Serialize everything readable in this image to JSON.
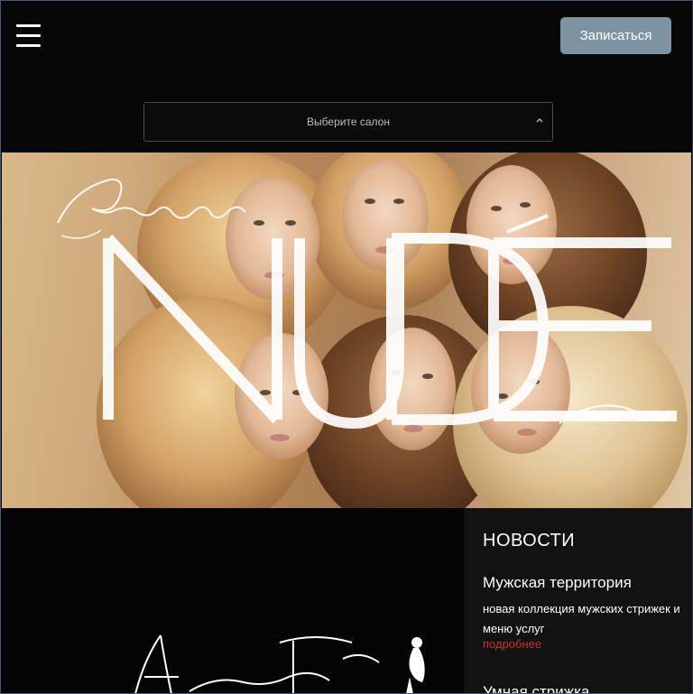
{
  "header": {
    "menu_icon": "hamburger-menu-icon",
    "book_button_label": "Записаться"
  },
  "salon_select": {
    "selected_label": "Выберите салон",
    "chevron_icon": "chevron-up-icon"
  },
  "hero": {
    "script_text": "Городской",
    "brand_text": "NUDE"
  },
  "news": {
    "heading": "НОВОСТИ",
    "items": [
      {
        "title": "Мужская территория",
        "description": "новая коллекция мужских стрижек и меню услуг",
        "more_link": "подробнее"
      },
      {
        "title": "Умная стрижка"
      }
    ]
  },
  "colors": {
    "book_button_bg": "#7d93a2",
    "more_link": "#c7332b",
    "background": "#070707"
  }
}
